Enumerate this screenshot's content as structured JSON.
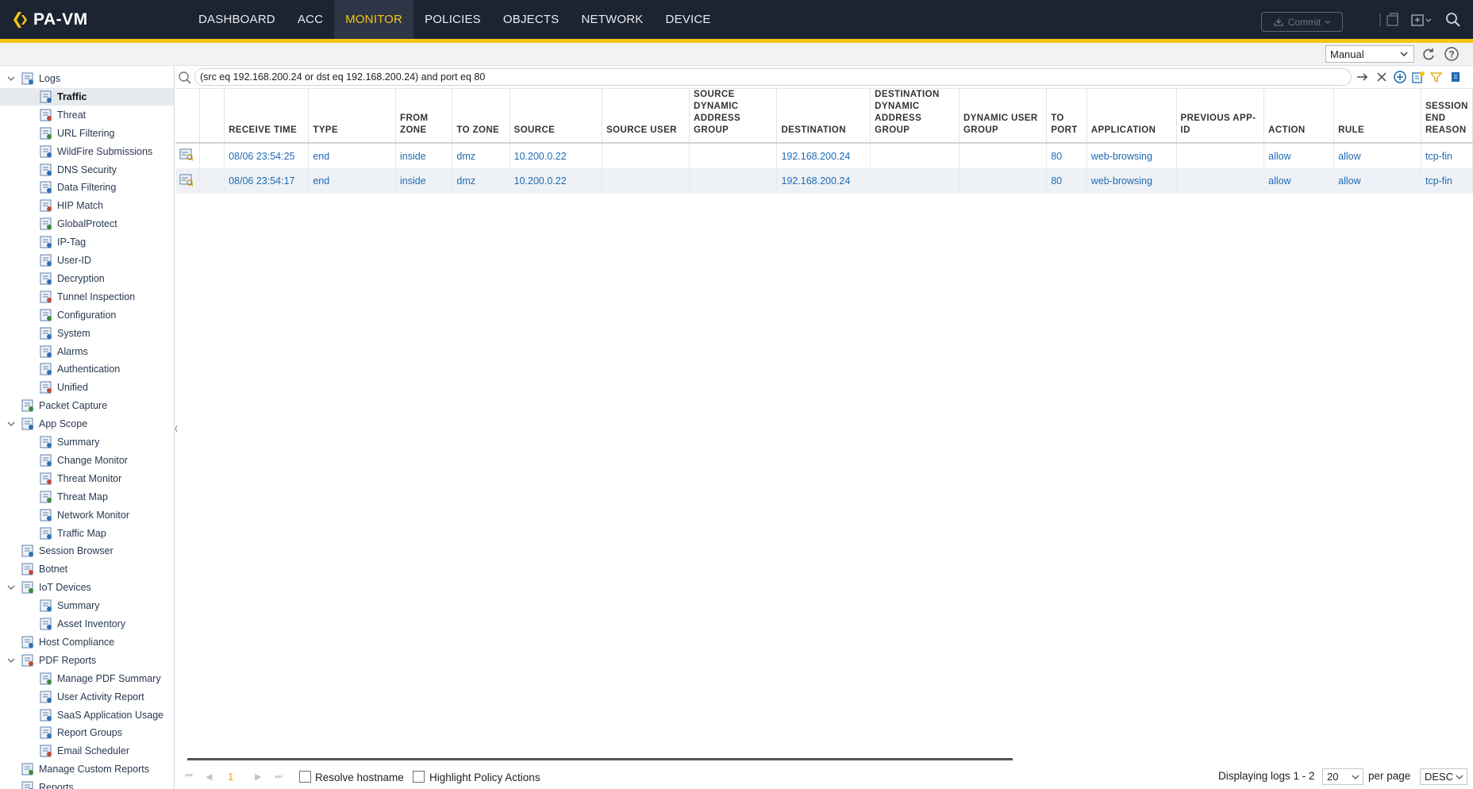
{
  "app": {
    "logo_text": "PA-VM"
  },
  "nav": {
    "items": [
      {
        "label": "DASHBOARD"
      },
      {
        "label": "ACC"
      },
      {
        "label": "MONITOR"
      },
      {
        "label": "POLICIES"
      },
      {
        "label": "OBJECTS"
      },
      {
        "label": "NETWORK"
      },
      {
        "label": "DEVICE"
      }
    ],
    "active": "MONITOR",
    "commit_label": "Commit"
  },
  "refresh": {
    "selected": "Manual"
  },
  "sidebar": {
    "items": [
      {
        "label": "Logs",
        "icon": "logs-folder-icon",
        "level": 0,
        "toggle": "expanded"
      },
      {
        "label": "Traffic",
        "icon": "traffic-log-icon",
        "level": 1,
        "selected": true
      },
      {
        "label": "Threat",
        "icon": "threat-log-icon",
        "level": 1
      },
      {
        "label": "URL Filtering",
        "icon": "url-filtering-icon",
        "level": 1
      },
      {
        "label": "WildFire Submissions",
        "icon": "wildfire-icon",
        "level": 1
      },
      {
        "label": "DNS Security",
        "icon": "dns-security-icon",
        "level": 1
      },
      {
        "label": "Data Filtering",
        "icon": "data-filtering-icon",
        "level": 1
      },
      {
        "label": "HIP Match",
        "icon": "hip-match-icon",
        "level": 1
      },
      {
        "label": "GlobalProtect",
        "icon": "globalprotect-icon",
        "level": 1
      },
      {
        "label": "IP-Tag",
        "icon": "ip-tag-icon",
        "level": 1
      },
      {
        "label": "User-ID",
        "icon": "user-id-icon",
        "level": 1
      },
      {
        "label": "Decryption",
        "icon": "decryption-icon",
        "level": 1
      },
      {
        "label": "Tunnel Inspection",
        "icon": "tunnel-inspection-icon",
        "level": 1
      },
      {
        "label": "Configuration",
        "icon": "configuration-log-icon",
        "level": 1
      },
      {
        "label": "System",
        "icon": "system-log-icon",
        "level": 1
      },
      {
        "label": "Alarms",
        "icon": "alarms-icon",
        "level": 1
      },
      {
        "label": "Authentication",
        "icon": "authentication-icon",
        "level": 1
      },
      {
        "label": "Unified",
        "icon": "unified-log-icon",
        "level": 1
      },
      {
        "label": "Packet Capture",
        "icon": "packet-capture-icon",
        "level": 0
      },
      {
        "label": "App Scope",
        "icon": "app-scope-icon",
        "level": 0,
        "toggle": "expanded"
      },
      {
        "label": "Summary",
        "icon": "summary-chart-icon",
        "level": 1
      },
      {
        "label": "Change Monitor",
        "icon": "change-monitor-icon",
        "level": 1
      },
      {
        "label": "Threat Monitor",
        "icon": "threat-monitor-icon",
        "level": 1
      },
      {
        "label": "Threat Map",
        "icon": "threat-map-icon",
        "level": 1
      },
      {
        "label": "Network Monitor",
        "icon": "network-monitor-icon",
        "level": 1
      },
      {
        "label": "Traffic Map",
        "icon": "traffic-map-icon",
        "level": 1
      },
      {
        "label": "Session Browser",
        "icon": "session-browser-icon",
        "level": 0
      },
      {
        "label": "Botnet",
        "icon": "botnet-icon",
        "level": 0
      },
      {
        "label": "IoT Devices",
        "icon": "iot-devices-icon",
        "level": 0,
        "toggle": "expanded"
      },
      {
        "label": "Summary",
        "icon": "summary-chart-icon",
        "level": 1
      },
      {
        "label": "Asset Inventory",
        "icon": "asset-inventory-icon",
        "level": 1
      },
      {
        "label": "Host Compliance",
        "icon": "host-compliance-icon",
        "level": 0
      },
      {
        "label": "PDF Reports",
        "icon": "pdf-reports-icon",
        "level": 0,
        "toggle": "expanded"
      },
      {
        "label": "Manage PDF Summary",
        "icon": "manage-pdf-icon",
        "level": 1
      },
      {
        "label": "User Activity Report",
        "icon": "user-activity-icon",
        "level": 1
      },
      {
        "label": "SaaS Application Usage",
        "icon": "saas-usage-icon",
        "level": 1
      },
      {
        "label": "Report Groups",
        "icon": "report-groups-icon",
        "level": 1
      },
      {
        "label": "Email Scheduler",
        "icon": "email-scheduler-icon",
        "level": 1
      },
      {
        "label": "Manage Custom Reports",
        "icon": "custom-reports-icon",
        "level": 0
      },
      {
        "label": "Reports",
        "icon": "reports-icon",
        "level": 0
      }
    ]
  },
  "filter": {
    "query": "(src eq 192.168.200.24 or dst eq 192.168.200.24) and port eq 80"
  },
  "table": {
    "columns": [
      "",
      "",
      "RECEIVE TIME",
      "TYPE",
      "FROM ZONE",
      "TO ZONE",
      "SOURCE",
      "SOURCE USER",
      "SOURCE DYNAMIC ADDRESS GROUP",
      "DESTINATION",
      "DESTINATION DYNAMIC ADDRESS GROUP",
      "DYNAMIC USER GROUP",
      "TO PORT",
      "APPLICATION",
      "PREVIOUS APP-ID",
      "ACTION",
      "RULE",
      "SESSION END REASON"
    ],
    "rows": [
      [
        "",
        "",
        "08/06 23:54:25",
        "end",
        "inside",
        "dmz",
        "10.200.0.22",
        "",
        "",
        "192.168.200.24",
        "",
        "",
        "80",
        "web-browsing",
        "",
        "allow",
        "allow",
        "tcp-fin"
      ],
      [
        "",
        "",
        "08/06 23:54:17",
        "end",
        "inside",
        "dmz",
        "10.200.0.22",
        "",
        "",
        "192.168.200.24",
        "",
        "",
        "80",
        "web-browsing",
        "",
        "allow",
        "allow",
        "tcp-fin"
      ]
    ]
  },
  "footer": {
    "page": "1",
    "resolve_hostname": "Resolve hostname",
    "highlight_policy": "Highlight Policy Actions",
    "displaying": "Displaying logs 1 - 2",
    "per_page_value": "20",
    "per_page_label": "per page",
    "sort": "DESC"
  },
  "colors": {
    "nav_bg": "#1c2331",
    "accent": "#f5c518",
    "link": "#1e6ab2"
  }
}
